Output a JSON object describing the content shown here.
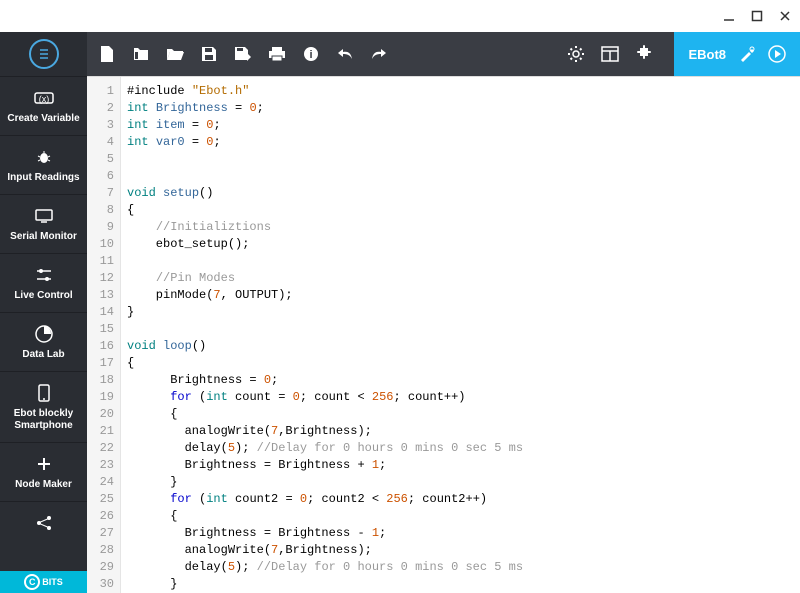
{
  "window": {
    "title": "EBot8"
  },
  "sidebar": {
    "items": [
      {
        "label": "Create Variable"
      },
      {
        "label": "Input Readings"
      },
      {
        "label": "Serial Monitor"
      },
      {
        "label": "Live Control"
      },
      {
        "label": "Data Lab"
      },
      {
        "label": "Ebot blockly Smartphone"
      },
      {
        "label": "Node Maker"
      }
    ],
    "bits_label": "BITS"
  },
  "toolbar": {
    "ebot_label": "EBot8"
  },
  "code": {
    "lines": [
      [
        [
          "#include ",
          "plain"
        ],
        [
          "\"Ebot.h\"",
          "string"
        ]
      ],
      [
        [
          "int ",
          "type"
        ],
        [
          "Brightness",
          "ident"
        ],
        [
          " = ",
          "plain"
        ],
        [
          "0",
          "num"
        ],
        [
          ";",
          "plain"
        ]
      ],
      [
        [
          "int ",
          "type"
        ],
        [
          "item",
          "ident"
        ],
        [
          " = ",
          "plain"
        ],
        [
          "0",
          "num"
        ],
        [
          ";",
          "plain"
        ]
      ],
      [
        [
          "int ",
          "type"
        ],
        [
          "var0",
          "ident"
        ],
        [
          " = ",
          "plain"
        ],
        [
          "0",
          "num"
        ],
        [
          ";",
          "plain"
        ]
      ],
      [],
      [],
      [
        [
          "void ",
          "type"
        ],
        [
          "setup",
          "ident"
        ],
        [
          "()",
          "plain"
        ]
      ],
      [
        [
          "{",
          "plain"
        ]
      ],
      [
        [
          "    ",
          "plain"
        ],
        [
          "//Initializtions",
          "comment"
        ]
      ],
      [
        [
          "    ebot_setup();",
          "plain"
        ]
      ],
      [],
      [
        [
          "    ",
          "plain"
        ],
        [
          "//Pin Modes",
          "comment"
        ]
      ],
      [
        [
          "    pinMode(",
          "plain"
        ],
        [
          "7",
          "num"
        ],
        [
          ", OUTPUT);",
          "plain"
        ]
      ],
      [
        [
          "}",
          "plain"
        ]
      ],
      [],
      [
        [
          "void ",
          "type"
        ],
        [
          "loop",
          "ident"
        ],
        [
          "()",
          "plain"
        ]
      ],
      [
        [
          "{",
          "plain"
        ]
      ],
      [
        [
          "      Brightness = ",
          "plain"
        ],
        [
          "0",
          "num"
        ],
        [
          ";",
          "plain"
        ]
      ],
      [
        [
          "      ",
          "plain"
        ],
        [
          "for ",
          "keyword"
        ],
        [
          "(",
          "plain"
        ],
        [
          "int ",
          "type"
        ],
        [
          "count = ",
          "plain"
        ],
        [
          "0",
          "num"
        ],
        [
          "; count < ",
          "plain"
        ],
        [
          "256",
          "num"
        ],
        [
          "; count++)",
          "plain"
        ]
      ],
      [
        [
          "      {",
          "plain"
        ]
      ],
      [
        [
          "        analogWrite(",
          "plain"
        ],
        [
          "7",
          "num"
        ],
        [
          ",Brightness);",
          "plain"
        ]
      ],
      [
        [
          "        delay(",
          "plain"
        ],
        [
          "5",
          "num"
        ],
        [
          "); ",
          "plain"
        ],
        [
          "//Delay for 0 hours 0 mins 0 sec 5 ms",
          "comment"
        ]
      ],
      [
        [
          "        Brightness = Brightness + ",
          "plain"
        ],
        [
          "1",
          "num"
        ],
        [
          ";",
          "plain"
        ]
      ],
      [
        [
          "      }",
          "plain"
        ]
      ],
      [
        [
          "      ",
          "plain"
        ],
        [
          "for ",
          "keyword"
        ],
        [
          "(",
          "plain"
        ],
        [
          "int ",
          "type"
        ],
        [
          "count2 = ",
          "plain"
        ],
        [
          "0",
          "num"
        ],
        [
          "; count2 < ",
          "plain"
        ],
        [
          "256",
          "num"
        ],
        [
          "; count2++)",
          "plain"
        ]
      ],
      [
        [
          "      {",
          "plain"
        ]
      ],
      [
        [
          "        Brightness = Brightness - ",
          "plain"
        ],
        [
          "1",
          "num"
        ],
        [
          ";",
          "plain"
        ]
      ],
      [
        [
          "        analogWrite(",
          "plain"
        ],
        [
          "7",
          "num"
        ],
        [
          ",Brightness);",
          "plain"
        ]
      ],
      [
        [
          "        delay(",
          "plain"
        ],
        [
          "5",
          "num"
        ],
        [
          "); ",
          "plain"
        ],
        [
          "//Delay for 0 hours 0 mins 0 sec 5 ms",
          "comment"
        ]
      ],
      [
        [
          "      }",
          "plain"
        ]
      ]
    ]
  }
}
